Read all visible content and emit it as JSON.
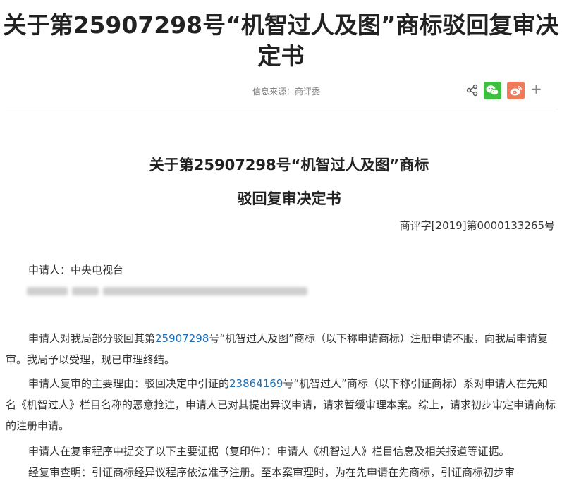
{
  "page": {
    "title_line1": "关于第25907298号“机智过人及图”商标驳回复审决",
    "title_line2": "定书",
    "source_label": "信息来源：商评委"
  },
  "share": {
    "more": "+"
  },
  "document": {
    "heading_line1": "关于第25907298号“机智过人及图”商标",
    "heading_line2": "驳回复审决定书",
    "reference_number": "商评字[2019]第0000133265号",
    "applicant": "申请人：中央电视台",
    "p1": {
      "a": "申请人对我局部分驳回其第",
      "link": "25907298",
      "b": "号“机智过人及图”商标（以下称申请商标）注册申请不服，向我局申请复审。我局予以受理，现已审理终结。"
    },
    "p2": {
      "a": "申请人复审的主要理由：驳回决定中引证的",
      "link": "23864169",
      "b": "号“机智过人”商标（以下称引证商标）系对申请人在先知名《机智过人》栏目名称的恶意抢注，申请人已对其提出异议申请，请求暂缓审理本案。综上，请求初步审定申请商标的注册申请。"
    },
    "p3": "申请人在复审程序中提交了以下主要证据（复印件）：申请人《机智过人》栏目信息及相关报道等证据。",
    "p4": "经复审查明：引证商标经异议程序依法准予注册。至本案审理时，为在先申请在先商标，引证商标初步审"
  },
  "colors": {
    "link": "#1f6fb5",
    "wechat": "#3fbf3f",
    "weibo": "#ef7a5c"
  }
}
